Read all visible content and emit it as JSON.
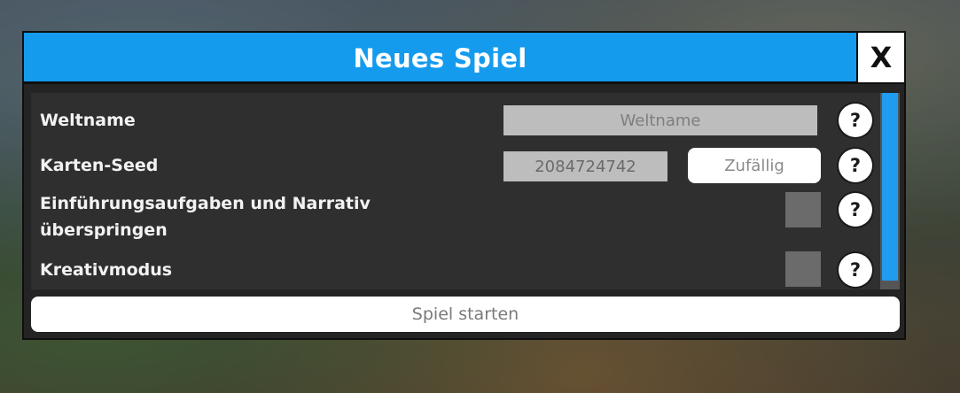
{
  "dialog": {
    "title": "Neues Spiel",
    "close_label": "X"
  },
  "rows": {
    "world_name": {
      "label": "Weltname",
      "placeholder": "Weltname",
      "value": ""
    },
    "map_seed": {
      "label": "Karten-Seed",
      "value": "2084724742",
      "random_label": "Zufällig"
    },
    "skip_intro": {
      "label_line1": "Einführungsaufgaben und Narrativ",
      "label_line2": "überspringen",
      "checked": false
    },
    "creative_mode": {
      "label": "Kreativmodus",
      "checked": false
    }
  },
  "help_label": "?",
  "start_label": "Spiel starten",
  "colors": {
    "accent": "#149bee",
    "panel": "#242424",
    "content": "#2f2f2f",
    "field": "#bdbdbd",
    "checkbox": "#6b6b6b"
  }
}
